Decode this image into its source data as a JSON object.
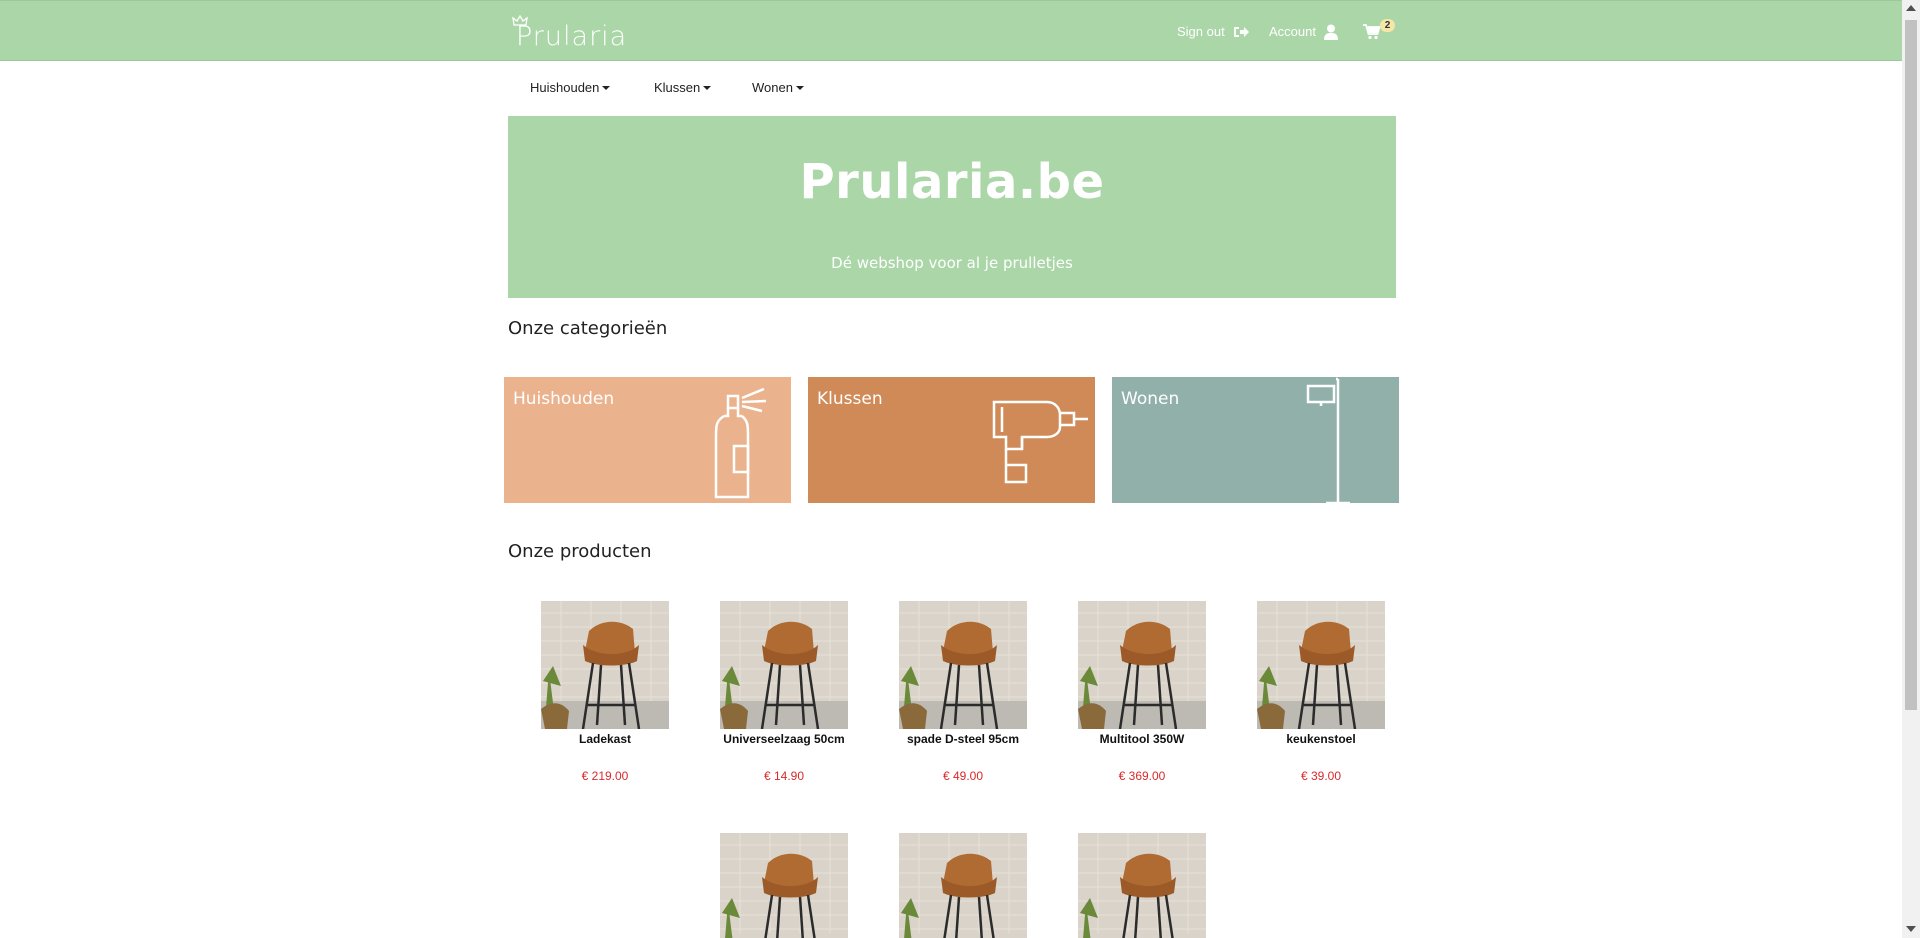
{
  "header": {
    "logo_text": "Prularia",
    "signout_label": "Sign out",
    "account_label": "Account",
    "cart_count": "2"
  },
  "menu": {
    "items": [
      {
        "label": "Huishouden"
      },
      {
        "label": "Klussen"
      },
      {
        "label": "Wonen"
      }
    ]
  },
  "hero": {
    "title": "Prularia.be",
    "subtitle": "Dé webshop voor al je prulletjes"
  },
  "categories": {
    "heading": "Onze categorieën",
    "items": [
      {
        "label": "Huishouden",
        "color": "#ebb28e",
        "icon": "spray-bottle-icon"
      },
      {
        "label": "Klussen",
        "color": "#cf8a58",
        "icon": "drill-icon"
      },
      {
        "label": "Wonen",
        "color": "#91b0aa",
        "icon": "lamp-icon"
      }
    ]
  },
  "products": {
    "heading": "Onze producten",
    "items": [
      {
        "name": "Ladekast",
        "price": "€ 219.00"
      },
      {
        "name": "Universeelzaag 50cm",
        "price": "€ 14.90"
      },
      {
        "name": "spade D-steel 95cm",
        "price": "€ 49.00"
      },
      {
        "name": "Multitool 350W",
        "price": "€ 369.00"
      },
      {
        "name": "keukenstoel",
        "price": "€ 39.00"
      },
      {
        "name": "",
        "price": ""
      },
      {
        "name": "",
        "price": ""
      },
      {
        "name": "",
        "price": ""
      }
    ]
  },
  "colors": {
    "brand_green": "#aad6a8",
    "price_red": "#d9292b"
  }
}
